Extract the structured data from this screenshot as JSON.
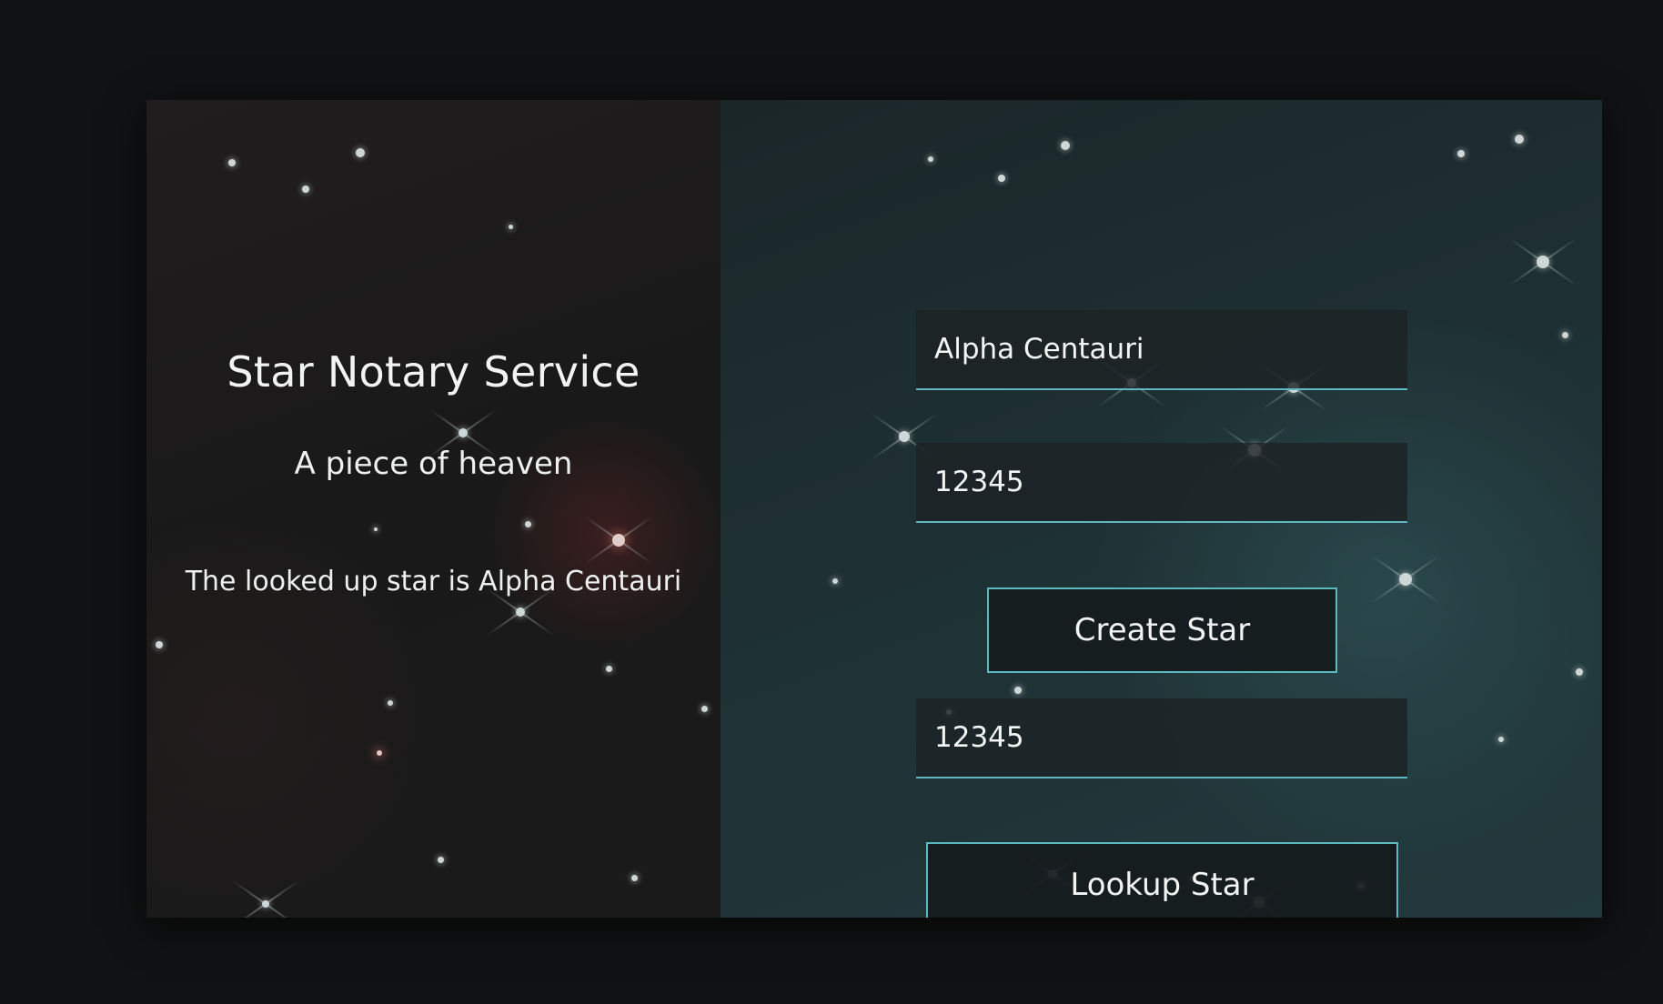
{
  "app": {
    "title": "Star Notary Service",
    "subtitle": "A piece of heaven",
    "status_message": "The looked up star is Alpha Centauri"
  },
  "form": {
    "star_name_input": {
      "value": "Alpha Centauri",
      "placeholder": ""
    },
    "create_star_id_input": {
      "value": "12345",
      "placeholder": ""
    },
    "create_button_label": "Create Star",
    "lookup_star_id_input": {
      "value": "12345",
      "placeholder": ""
    },
    "lookup_button_label": "Lookup Star"
  },
  "colors": {
    "accent": "#5db8c0",
    "page_background": "#111213",
    "text": "#f2f4f4"
  }
}
